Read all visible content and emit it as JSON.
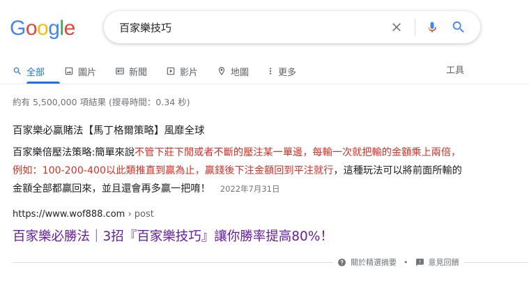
{
  "logo": {
    "letters": [
      "G",
      "o",
      "o",
      "g",
      "l",
      "e"
    ],
    "colors": [
      "#4285f4",
      "#ea4335",
      "#fbbc05",
      "#4285f4",
      "#34a853",
      "#ea4335"
    ]
  },
  "search": {
    "query": "百家樂技巧"
  },
  "tabs": [
    {
      "label": "全部",
      "icon": "search-icon"
    },
    {
      "label": "圖片",
      "icon": "image-icon"
    },
    {
      "label": "新聞",
      "icon": "news-icon"
    },
    {
      "label": "影片",
      "icon": "video-icon"
    },
    {
      "label": "地圖",
      "icon": "map-pin-icon"
    },
    {
      "label": "更多",
      "icon": "more-vert-icon"
    }
  ],
  "tools_label": "工具",
  "result_stats": "約有 5,500,000 項結果 (搜尋時間：0.34 秒)",
  "snippet": {
    "title": "百家樂必贏賭法【馬丁格爾策略】風靡全球",
    "text_before": "百家樂倍壓法策略:簡單來說",
    "highlight": "不管下莊下閒或者不斷的壓注某一單邊，每輸一次就把輸的金額乘上兩倍，例如：100-200-400以此類推直到贏為止，贏錢後下注金額回到平注就行",
    "text_after": "，這種玩法可以將前面所輸的金額全部都贏回來，並且還會再多贏一把唷！",
    "date": "2022年7月31日"
  },
  "result": {
    "url": "https://www.wof888.com",
    "breadcrumb": " › post",
    "title": "百家樂必勝法｜3招『百家樂技巧』讓你勝率提高80%！"
  },
  "footer": {
    "about": "關於精選摘要",
    "separator": "•",
    "feedback": "意見回饋"
  },
  "colors": {
    "accent": "#1a73e8",
    "visited_link": "#681da8",
    "highlight": "#d93025"
  }
}
